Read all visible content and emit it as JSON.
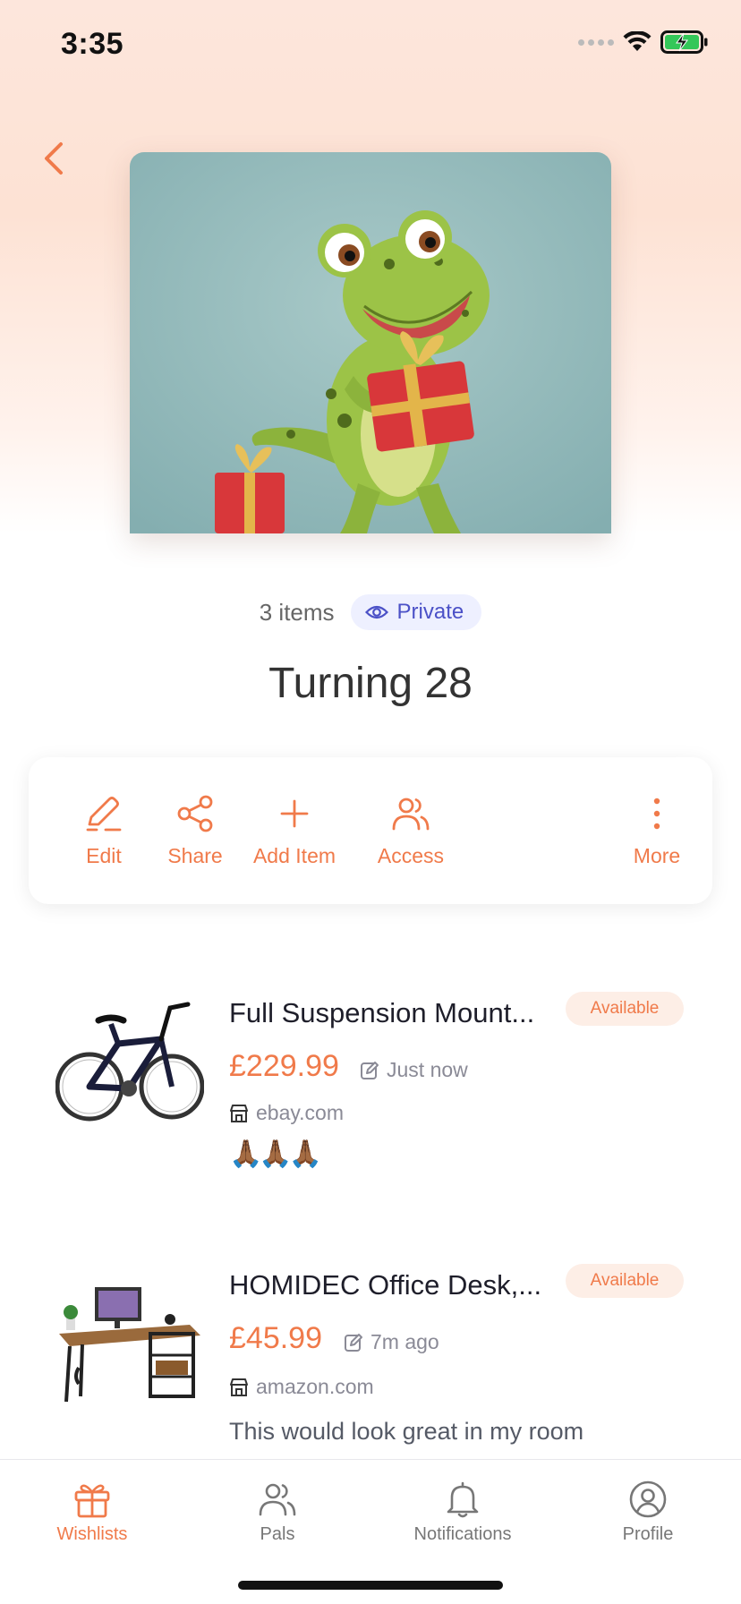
{
  "status_bar": {
    "time": "3:35"
  },
  "wishlist": {
    "item_count": "3 items",
    "privacy": "Private",
    "title": "Turning 28"
  },
  "actions": {
    "edit": "Edit",
    "share": "Share",
    "add_item": "Add Item",
    "access": "Access",
    "more": "More"
  },
  "items": [
    {
      "title": "Full Suspension Mount...",
      "status": "Available",
      "price": "£229.99",
      "updated": "Just now",
      "store": "ebay.com",
      "reaction": "🙏🏾🙏🏾🙏🏾"
    },
    {
      "title": "HOMIDEC Office Desk,...",
      "status": "Available",
      "price": "£45.99",
      "updated": "7m ago",
      "store": "amazon.com",
      "note": "This would look great in my room"
    }
  ],
  "tabs": {
    "wishlists": "Wishlists",
    "pals": "Pals",
    "notifications": "Notifications",
    "profile": "Profile"
  },
  "colors": {
    "accent": "#f07a4a",
    "privacy_text": "#4b51c7",
    "privacy_bg": "#eef0ff",
    "battery": "#34c759"
  },
  "icons": [
    "back-chevron-icon",
    "eye-icon",
    "pencil-icon",
    "share-icon",
    "plus-icon",
    "users-icon",
    "more-vertical-icon",
    "edit-note-icon",
    "store-icon",
    "gift-icon",
    "bell-icon",
    "profile-icon",
    "wifi-icon",
    "battery-icon"
  ]
}
